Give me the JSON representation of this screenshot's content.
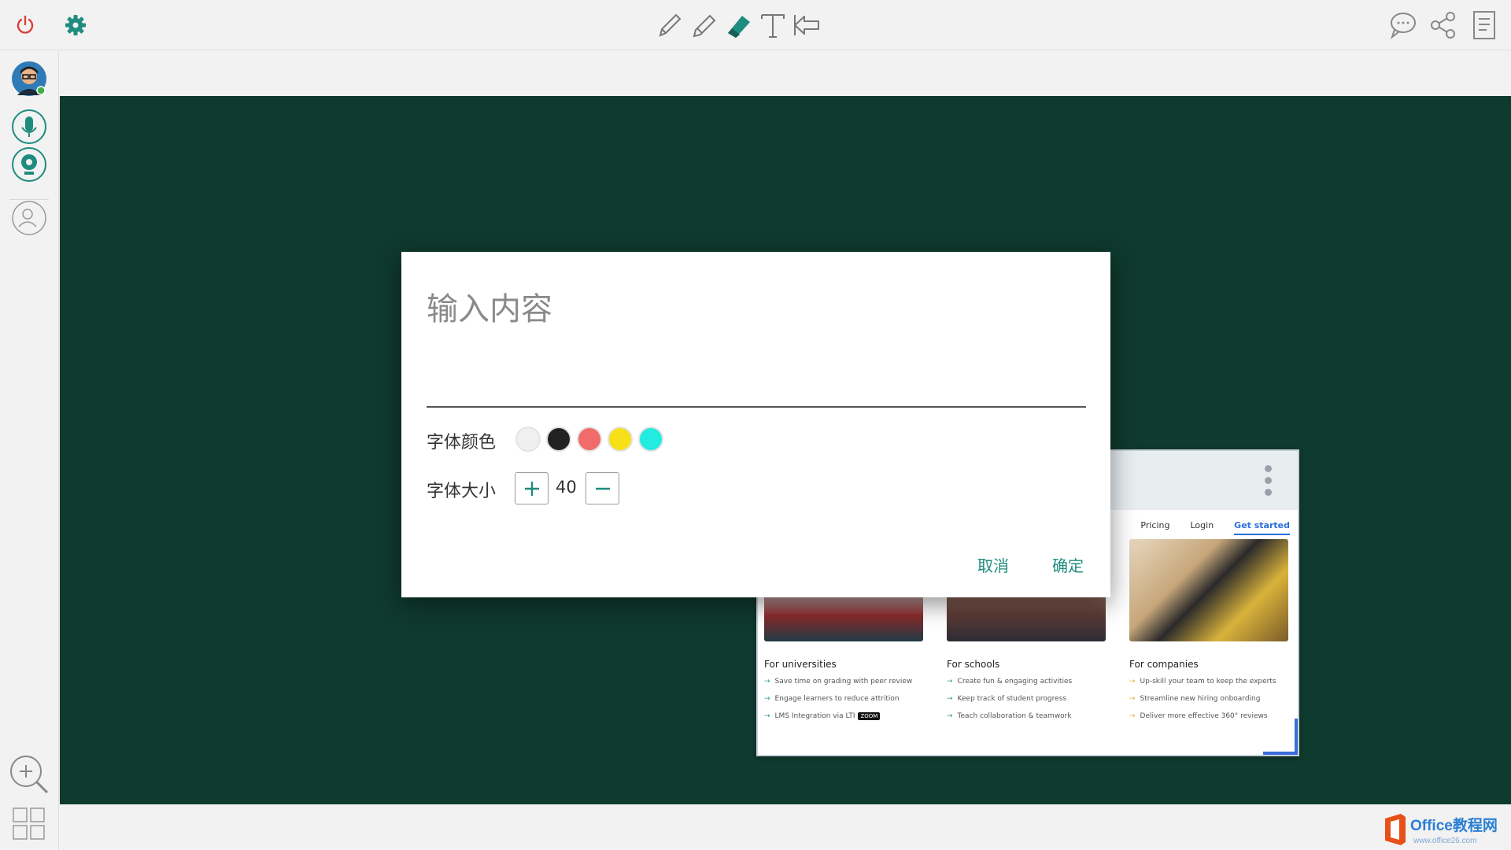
{
  "toolbar": {
    "left": [
      {
        "name": "power-icon"
      },
      {
        "name": "gear-icon"
      }
    ],
    "center": [
      {
        "name": "pencil-icon"
      },
      {
        "name": "highlighter-icon"
      },
      {
        "name": "eraser-icon"
      },
      {
        "name": "text-icon"
      },
      {
        "name": "undo-arrow-icon"
      }
    ],
    "right": [
      {
        "name": "chat-icon"
      },
      {
        "name": "share-icon"
      },
      {
        "name": "notes-icon"
      }
    ]
  },
  "sidebar": {
    "items": [
      {
        "name": "avatar"
      },
      {
        "name": "microphone-icon"
      },
      {
        "name": "camera-icon"
      },
      {
        "name": "user-icon"
      }
    ],
    "bottom": [
      {
        "name": "zoom-in-icon"
      },
      {
        "name": "grid-icon"
      }
    ]
  },
  "canvas": {
    "background": "#0f3a2e"
  },
  "shared_page": {
    "nav": [
      "Pricing",
      "Login",
      "Get started"
    ],
    "columns": [
      {
        "title": "For universities",
        "items": [
          "Save time on grading with peer review",
          "Engage learners to reduce attrition",
          "LMS Integration via LTI"
        ],
        "badge": "ZOOM"
      },
      {
        "title": "For schools",
        "items": [
          "Create fun & engaging activities",
          "Keep track of student progress",
          "Teach collaboration & teamwork"
        ]
      },
      {
        "title": "For companies",
        "items": [
          "Up-skill your team to keep the experts",
          "Streamline new hiring onboarding",
          "Deliver more effective 360° reviews"
        ]
      }
    ]
  },
  "dialog": {
    "placeholder": "输入内容",
    "font_color_label": "字体颜色",
    "font_colors": [
      "#f0f0f0",
      "#222222",
      "#f26b6b",
      "#f7e017",
      "#22ece0"
    ],
    "font_size_label": "字体大小",
    "font_size": "40",
    "cancel_label": "取消",
    "confirm_label": "确定"
  },
  "watermark": {
    "text": "Office教程网",
    "sub": "www.office26.com"
  }
}
